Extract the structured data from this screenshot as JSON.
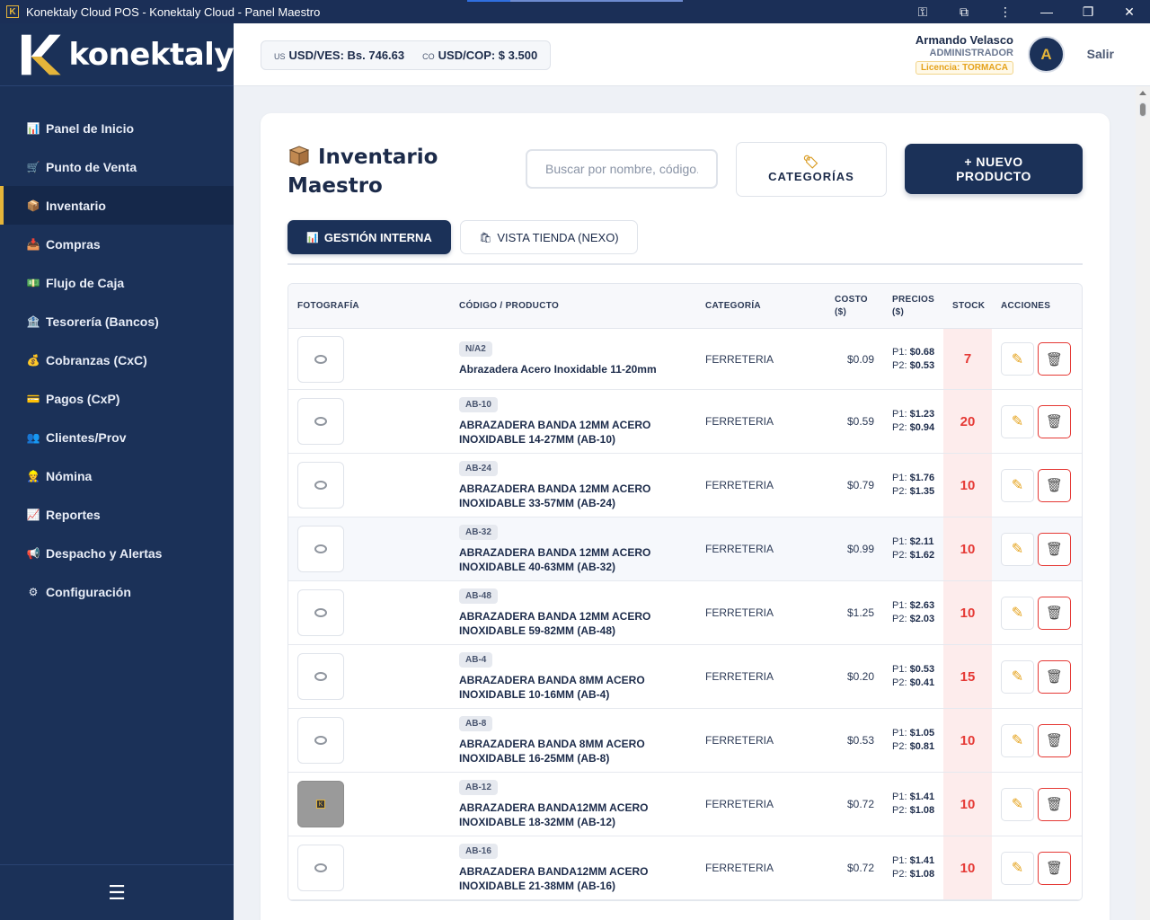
{
  "window": {
    "title": "Konektaly Cloud POS - Konektaly Cloud - Panel Maestro",
    "controls": [
      "key-icon",
      "extension-icon",
      "more-icon",
      "minimize-icon",
      "restore-icon",
      "close-icon"
    ]
  },
  "brand": {
    "name": "konektaly",
    "accent": "#e5b53a",
    "primary": "#1b3158"
  },
  "sidebar": {
    "items": [
      {
        "label": "Panel de Inicio",
        "icon": "chart-icon",
        "active": false
      },
      {
        "label": "Punto de Venta",
        "icon": "cart-icon",
        "active": false
      },
      {
        "label": "Inventario",
        "icon": "box-icon",
        "active": true
      },
      {
        "label": "Compras",
        "icon": "inbox-icon",
        "active": false
      },
      {
        "label": "Flujo de Caja",
        "icon": "cash-icon",
        "active": false
      },
      {
        "label": "Tesorería (Bancos)",
        "icon": "bank-icon",
        "active": false
      },
      {
        "label": "Cobranzas (CxC)",
        "icon": "money-bag-icon",
        "active": false
      },
      {
        "label": "Pagos (CxP)",
        "icon": "card-icon",
        "active": false
      },
      {
        "label": "Clientes/Prov",
        "icon": "users-icon",
        "active": false
      },
      {
        "label": "Nómina",
        "icon": "worker-icon",
        "active": false
      },
      {
        "label": "Reportes",
        "icon": "trend-icon",
        "active": false
      },
      {
        "label": "Despacho y Alertas",
        "icon": "megaphone-icon",
        "active": false
      },
      {
        "label": "Configuración",
        "icon": "gear-icon",
        "active": false
      }
    ],
    "footer_icon": "menu-icon"
  },
  "header": {
    "rates": [
      {
        "flag": "US",
        "label": "USD/VES: Bs. 746.63"
      },
      {
        "flag": "CO",
        "label": "USD/COP: $ 3.500"
      }
    ],
    "user": {
      "name": "Armando Velasco",
      "role": "ADMINISTRADOR",
      "license": "Licencia: TORMACA",
      "initial": "A"
    },
    "logout": "Salir"
  },
  "main": {
    "title": "Inventario Maestro",
    "search_placeholder": "Buscar por nombre, código...",
    "categories_button": "CATEGORÍAS",
    "new_product_button": "+ NUEVO PRODUCTO",
    "tabs": [
      {
        "label": "GESTIÓN INTERNA",
        "icon": "chart-icon"
      },
      {
        "label": "VISTA TIENDA (NEXO)",
        "icon": "shopping-bag-icon"
      }
    ],
    "table": {
      "headers": [
        "FOTOGRAFÍA",
        "CÓDIGO / PRODUCTO",
        "CATEGORÍA",
        "COSTO ($)",
        "PRECIOS ($)",
        "STOCK",
        "ACCIONES"
      ],
      "rows": [
        {
          "code": "N/A2",
          "name": "Abrazadera Acero Inoxidable 11-20mm",
          "category": "FERRETERIA",
          "cost": "$0.09",
          "p1": "$0.68",
          "p2": "$0.53",
          "stock": "7"
        },
        {
          "code": "AB-10",
          "name": "ABRAZADERA BANDA 12MM ACERO INOXIDABLE 14-27MM (AB-10)",
          "category": "FERRETERIA",
          "cost": "$0.59",
          "p1": "$1.23",
          "p2": "$0.94",
          "stock": "20"
        },
        {
          "code": "AB-24",
          "name": "ABRAZADERA BANDA 12MM ACERO INOXIDABLE 33-57MM (AB-24)",
          "category": "FERRETERIA",
          "cost": "$0.79",
          "p1": "$1.76",
          "p2": "$1.35",
          "stock": "10"
        },
        {
          "code": "AB-32",
          "name": "ABRAZADERA BANDA 12MM ACERO INOXIDABLE 40-63MM (AB-32)",
          "category": "FERRETERIA",
          "cost": "$0.99",
          "p1": "$2.11",
          "p2": "$1.62",
          "stock": "10"
        },
        {
          "code": "AB-48",
          "name": "ABRAZADERA BANDA 12MM ACERO INOXIDABLE 59-82MM (AB-48)",
          "category": "FERRETERIA",
          "cost": "$1.25",
          "p1": "$2.63",
          "p2": "$2.03",
          "stock": "10"
        },
        {
          "code": "AB-4",
          "name": "ABRAZADERA BANDA 8MM ACERO INOXIDABLE 10-16MM (AB-4)",
          "category": "FERRETERIA",
          "cost": "$0.20",
          "p1": "$0.53",
          "p2": "$0.41",
          "stock": "15"
        },
        {
          "code": "AB-8",
          "name": "ABRAZADERA BANDA 8MM ACERO INOXIDABLE 16-25MM (AB-8)",
          "category": "FERRETERIA",
          "cost": "$0.53",
          "p1": "$1.05",
          "p2": "$0.81",
          "stock": "10"
        },
        {
          "code": "AB-12",
          "name": "ABRAZADERA BANDA12MM ACERO INOXIDABLE 18-32MM (AB-12)",
          "category": "FERRETERIA",
          "cost": "$0.72",
          "p1": "$1.41",
          "p2": "$1.08",
          "stock": "10"
        },
        {
          "code": "AB-16",
          "name": "ABRAZADERA BANDA12MM ACERO INOXIDABLE 21-38MM (AB-16)",
          "category": "FERRETERIA",
          "cost": "$0.72",
          "p1": "$1.41",
          "p2": "$1.08",
          "stock": "10"
        }
      ]
    }
  }
}
